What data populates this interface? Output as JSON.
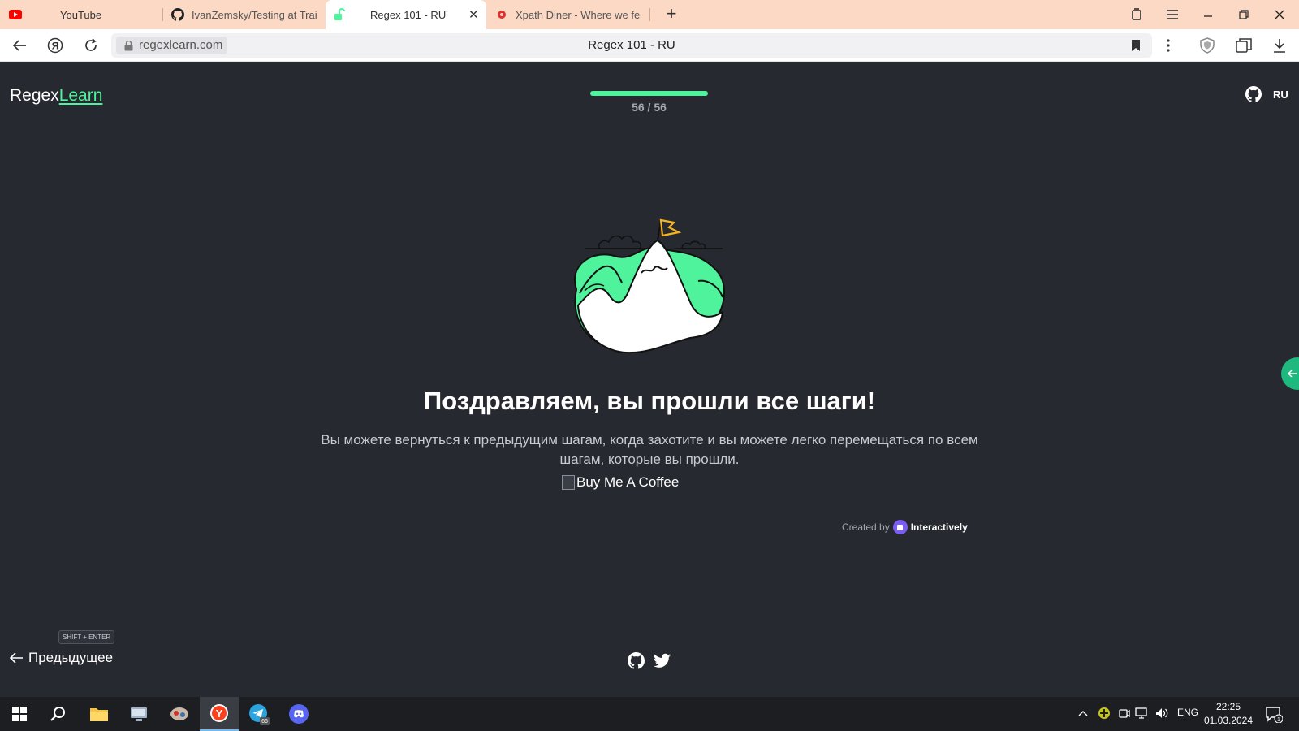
{
  "browser": {
    "tabs": [
      {
        "title": "YouTube",
        "icon": "youtube-icon"
      },
      {
        "title": "IvanZemsky/Testing at Trai",
        "icon": "github-icon"
      },
      {
        "title": "Regex 101 - RU",
        "icon": "regexlearn-icon",
        "active": true
      },
      {
        "title": "Xpath Diner - Where we fe",
        "icon": "xpath-diner-icon"
      }
    ],
    "url": "regexlearn.com",
    "page_title": "Regex 101 - RU"
  },
  "header": {
    "logo_regex": "Regex",
    "logo_learn": "Learn",
    "progress": "56 / 56",
    "progress_fraction": 1.0,
    "lang": "RU"
  },
  "main": {
    "heading": "Поздравляем, вы прошли все шаги!",
    "description": "Вы можете вернуться к предыдущим шагам, когда захотите и вы можете легко перемещаться по всем шагам, которые вы прошли.",
    "coffee_alt": "Buy Me A Coffee",
    "created_by": "Created by",
    "brand": "Interactively"
  },
  "footer": {
    "shortcut": "SHIFT + ENTER",
    "prev_label": "Предыдущее"
  },
  "taskbar": {
    "lang": "ENG",
    "time": "22:25",
    "date": "01.03.2024",
    "telegram_badge": "66",
    "notification_badge": "1"
  },
  "colors": {
    "accent": "#4ff39b",
    "page_bg": "#262930",
    "tab_strip": "#fbd9c4"
  }
}
